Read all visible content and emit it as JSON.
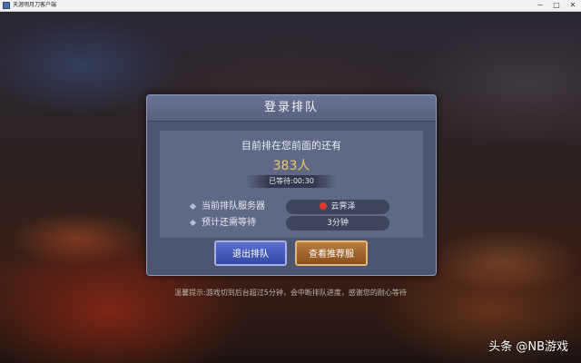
{
  "window": {
    "title": "天涯明月刀客户端",
    "minimize": "─",
    "maximize": "□",
    "close": "✕"
  },
  "dialog": {
    "title": "登录排队",
    "queue_text": "目前排在您前面的还有",
    "queue_count": "383人",
    "wait_time": "已等待:00:30",
    "server_label": "当前排队服务器",
    "server_name": "云霁泽",
    "server_status_color": "#e3382c",
    "eta_label": "预计还需等待",
    "eta_value": "3分钟",
    "exit_button": "退出排队",
    "recommend_button": "查看推荐服"
  },
  "hint": "温馨提示:游戏切到后台超过5分钟，会中断排队进度，感谢您的耐心等待",
  "watermark": "头条 @NB游戏"
}
